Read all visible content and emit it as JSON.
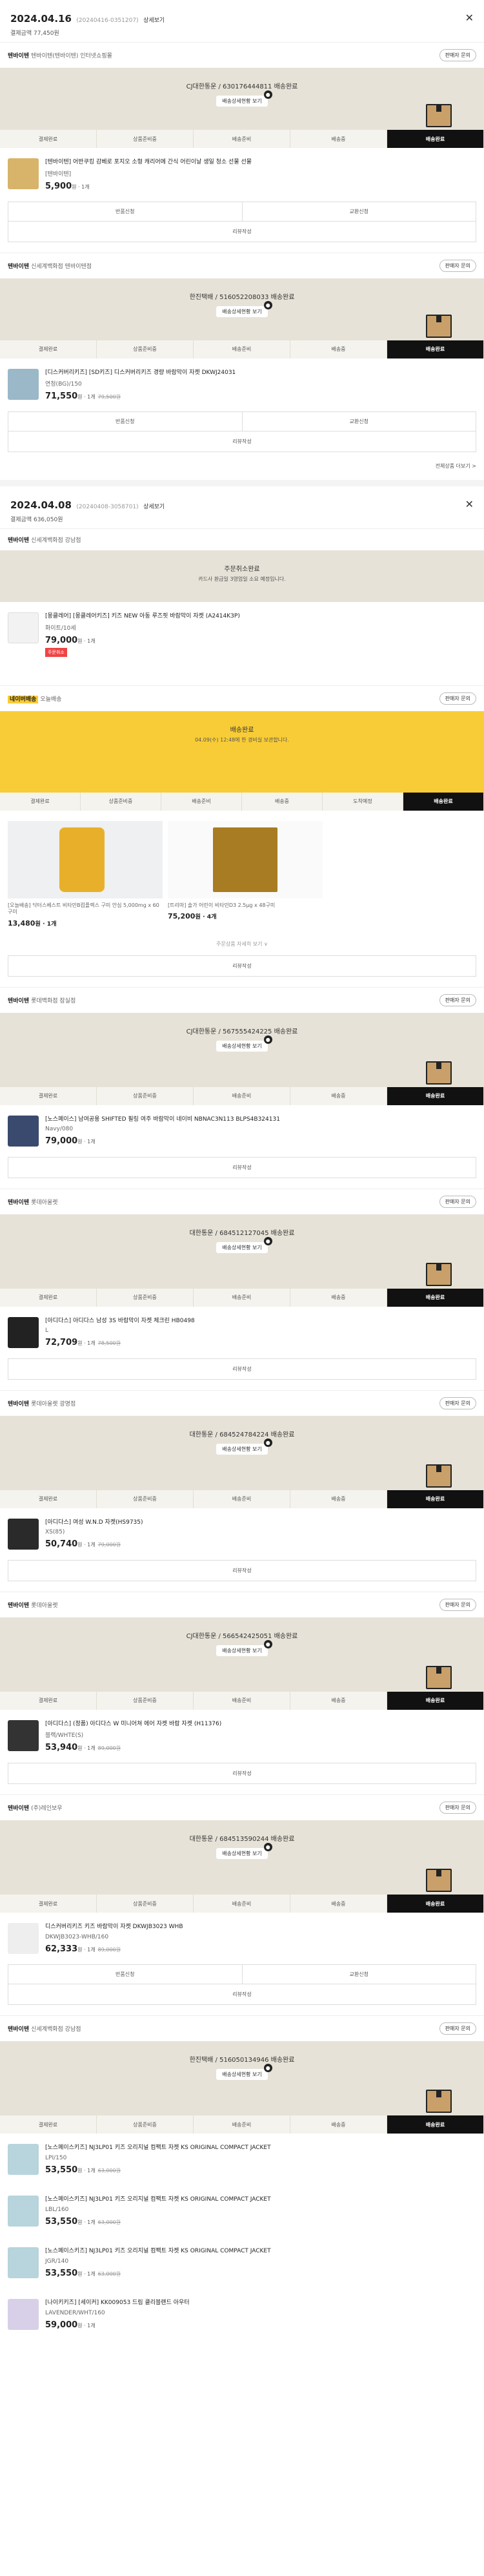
{
  "order1": {
    "date": "2024.04.16",
    "no": "(20240416-0351207)",
    "detail": "상세보기",
    "total": "결제금액 77,450원",
    "close": "✕",
    "shop1": {
      "brand": "텐바이텐",
      "name": "텐바이텐(텐바이텐) 인터넷쇼핑몰",
      "qa": "판매자 문의",
      "carrier": "CJ대한통운 / 630176444811 배송완료",
      "track_btn": "배송상세현황 보기",
      "steps": [
        "결제완료",
        "상품준비중",
        "배송준비",
        "배송중",
        "배송완료"
      ],
      "product": {
        "name": "[텐바이텐] 어반쿠킹 감베로 포지오 소형 캐리어에 간식 어린이날 생일 청소 선물 선물",
        "opt": "[텐바이텐]",
        "price": "5,900",
        "unit": "원 · 1개"
      },
      "btn_left": "반품신청",
      "btn_right": "교환신청",
      "btn_full": "리뷰작성"
    },
    "shop2": {
      "brand": "텐바이텐",
      "name": "신세계백화점 텐바이텐점",
      "qa": "판매자 문의",
      "carrier": "한진택배 / 516052208033 배송완료",
      "track_btn": "배송상세현황 보기",
      "steps": [
        "결제완료",
        "상품준비중",
        "배송준비",
        "배송중",
        "배송완료"
      ],
      "product": {
        "name": "[디스커버리키즈] [SD키즈] 디스커버리키즈 경량 바람막이 자켓 DKWJ24031",
        "opt": "연청(BG)/150",
        "price": "71,550",
        "orig": "79,500원",
        "unit": "원 · 1개"
      },
      "btn_left": "반품신청",
      "btn_right": "교환신청",
      "btn_full": "리뷰작성",
      "more": "전체상품 더보기 >"
    }
  },
  "order2": {
    "date": "2024.04.08",
    "no": "(20240408-3058701)",
    "detail": "상세보기",
    "total": "결제금액 636,050원",
    "close": "✕",
    "shop1": {
      "brand": "텐바이텐",
      "name": "신세계백화점 강남점",
      "qa": "판매자 문의",
      "status": "주문취소완료",
      "status_sub": "카드사 환급일 3영업일 소요 예정입니다.",
      "product": {
        "name": "[몽클레어] [몽클레어키즈] 키즈 NEW 아동 루즈핏 바람막이 자켓 (A2414K3P)",
        "opt": "화이트/10세",
        "price": "79,000",
        "unit": "원 · 1개",
        "badge": "주문취소"
      }
    },
    "shop2": {
      "brand": "네이버배송",
      "name": "오늘배송",
      "qa": "판매자 문의",
      "status": "배송완료",
      "status_sub": "04.09(수) 12:48에 한 경비실 보관합니다.",
      "steps": [
        "결제완료",
        "상품준비중",
        "배송준비",
        "배송중",
        "도착예정",
        "배송완료"
      ],
      "items": [
        {
          "name": "[오늘배송] 닥터스베스트 비타민B컴플렉스 구미 안심 5,000mg x 60구미",
          "price": "13,480",
          "unit": "원 · 1개"
        },
        {
          "name": "[트리마] 솔가 어린이 비타민D3 2.5µg x 48구미",
          "price": "75,200",
          "unit": "원 · 4개"
        }
      ],
      "more": "주문상품 자세히 보기 ∨",
      "btn_full": "리뷰작성"
    },
    "shops": [
      {
        "brand": "텐바이텐",
        "name": "롯데백화점 잠실점",
        "qa": "판매자 문의",
        "carrier": "CJ대한통운 / 567555424225 배송완료",
        "track_btn": "배송상세현황 보기",
        "steps": [
          "결제완료",
          "상품준비중",
          "배송준비",
          "배송중",
          "배송완료"
        ],
        "product": {
          "name": "[노스페이스] 남여공용 SHIFTED 필링 여주 바람막이 네이비 NBNAC3N113 BLPS4B324131",
          "opt": "Navy/080",
          "price": "79,000",
          "unit": "원 · 1개"
        },
        "btn_full": "리뷰작성"
      },
      {
        "brand": "텐바이텐",
        "name": "롯데아울렛",
        "qa": "판매자 문의",
        "carrier": "대한통운 / 684512127045 배송완료",
        "track_btn": "배송상세현황 보기",
        "steps": [
          "결제완료",
          "상품준비중",
          "배송준비",
          "배송중",
          "배송완료"
        ],
        "product": {
          "name": "[아디다스] 아디다스 남성 3S 바람막이 자켓 체크린 HB0498",
          "opt": "L",
          "price": "72,709",
          "orig": "78,500원",
          "unit": "원 · 1개"
        },
        "btn_full": "리뷰작성"
      },
      {
        "brand": "텐바이텐",
        "name": "롯데아울렛 광명점",
        "qa": "판매자 문의",
        "carrier": "대한통운 / 684524784224 배송완료",
        "track_btn": "배송상세현황 보기",
        "steps": [
          "결제완료",
          "상품준비중",
          "배송준비",
          "배송중",
          "배송완료"
        ],
        "product": {
          "name": "[아디다스] 여성 W.N.D 자켓(HS9735)",
          "opt": "XS(85)",
          "price": "50,740",
          "orig": "79,000원",
          "unit": "원 · 1개"
        },
        "btn_full": "리뷰작성"
      },
      {
        "brand": "텐바이텐",
        "name": "롯데아울렛",
        "qa": "판매자 문의",
        "carrier": "CJ대한통운 / 566542425051 배송완료",
        "track_btn": "배송상세현황 보기",
        "steps": [
          "결제완료",
          "상품준비중",
          "배송준비",
          "배송중",
          "배송완료"
        ],
        "product": {
          "name": "[아디다스] (정품) 아디다스 W 미니어쳐 에어 자켓 바람 자켓 (H11376)",
          "opt": "블랙/WHTE(S)",
          "price": "53,940",
          "orig": "89,000원",
          "unit": "원 · 1개"
        },
        "btn_full": "리뷰작성"
      },
      {
        "brand": "텐바이텐",
        "name": "(주)레인보우",
        "qa": "판매자 문의",
        "carrier": "대한통운 / 684513590244 배송완료",
        "track_btn": "배송상세현황 보기",
        "steps": [
          "결제완료",
          "상품준비중",
          "배송준비",
          "배송중",
          "배송완료"
        ],
        "product": {
          "name": "디스커버리키즈 키즈 바람막이 자켓 DKWJB3023 WHB",
          "opt": "DKWJB3023-WHB/160",
          "price": "62,333",
          "orig": "89,000원",
          "unit": "원 · 1개"
        },
        "btn_left": "반품신청",
        "btn_right": "교환신청",
        "btn_full": "리뷰작성"
      },
      {
        "brand": "텐바이텐",
        "name": "신세계백화점 강남점",
        "qa": "판매자 문의",
        "carrier": "한진택배 / 516050134946 배송완료",
        "track_btn": "배송상세현황 보기",
        "steps": [
          "결제완료",
          "상품준비중",
          "배송준비",
          "배송중",
          "배송완료"
        ],
        "products": [
          {
            "name": "[노스페이스키즈] NJ3LP01 키즈 오리지널 컴팩트 자켓 KS ORIGINAL COMPACT JACKET",
            "opt": "LPI/150",
            "price": "53,550",
            "orig": "63,000원",
            "unit": "원 · 1개"
          },
          {
            "name": "[노스페이스키즈] NJ3LP01 키즈 오리지널 컴팩트 자켓 KS ORIGINAL COMPACT JACKET",
            "opt": "LBL/160",
            "price": "53,550",
            "orig": "63,000원",
            "unit": "원 · 1개"
          },
          {
            "name": "[노스페이스키즈] NJ3LP01 키즈 오리지널 컴팩트 자켓 KS ORIGINAL COMPACT JACKET",
            "opt": "JGR/140",
            "price": "53,550",
            "orig": "63,000원",
            "unit": "원 · 1개"
          },
          {
            "name": "[나이키키즈] [세이커] KK009053 드림 클리블랜드 아우터",
            "opt": "LAVENDER/WHT/160",
            "price": "59,000",
            "unit": "원 · 1개"
          }
        ]
      }
    ]
  }
}
